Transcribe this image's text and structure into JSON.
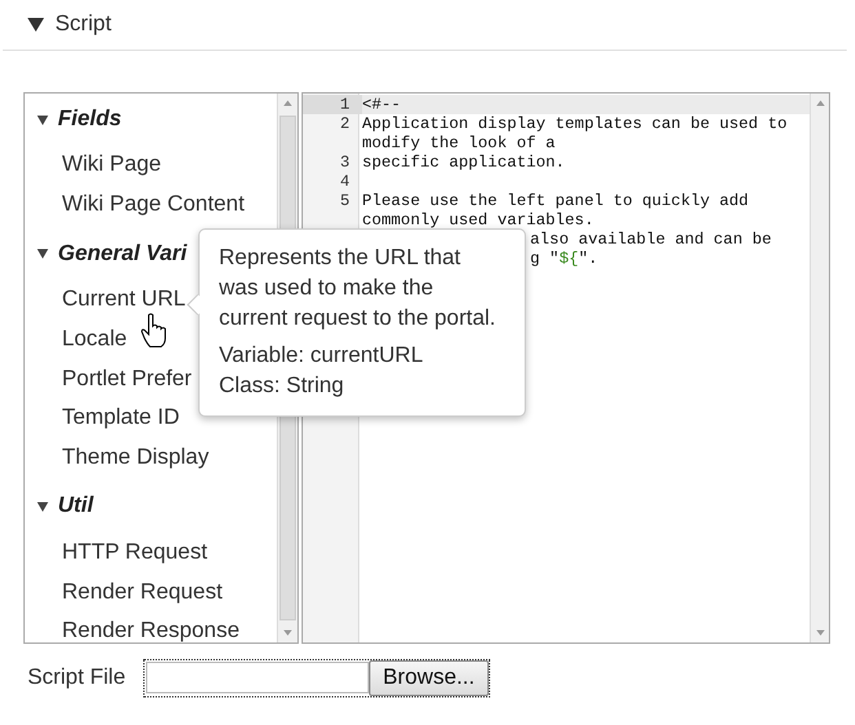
{
  "section": {
    "title": "Script",
    "expanded": true
  },
  "variables_panel": {
    "groups": [
      {
        "title": "Fields",
        "expanded": true,
        "items": [
          {
            "label": "Wiki Page"
          },
          {
            "label": "Wiki Page Content"
          }
        ]
      },
      {
        "title": "General Vari",
        "expanded": true,
        "items": [
          {
            "label": "Current URL"
          },
          {
            "label": "Locale"
          },
          {
            "label": "Portlet Prefer"
          },
          {
            "label": "Template ID"
          },
          {
            "label": "Theme Display"
          }
        ]
      },
      {
        "title": "Util",
        "expanded": true,
        "items": [
          {
            "label": "HTTP Request"
          },
          {
            "label": "Render Request"
          },
          {
            "label": "Render Response"
          }
        ]
      }
    ]
  },
  "editor": {
    "lines": [
      {
        "number": "1",
        "current": true,
        "parts": [
          {
            "kind": "plain",
            "text": "<#--"
          }
        ]
      },
      {
        "number": "2",
        "current": false,
        "parts": [
          {
            "kind": "plain",
            "text": "Application display templates can be used to modify the look of a"
          }
        ]
      },
      {
        "number": "3",
        "current": false,
        "parts": [
          {
            "kind": "plain",
            "text": "specific application."
          }
        ]
      },
      {
        "number": "4",
        "current": false
      },
      {
        "number": "5",
        "current": false,
        "parts": [
          {
            "kind": "plain",
            "text": "Please use the left panel to quickly add commonly used variables."
          }
        ]
      },
      {
        "kind": "partial",
        "current": false,
        "parts": [
          {
            "kind": "plain",
            "text": "also available and can be"
          }
        ]
      },
      {
        "kind": "partial",
        "current": false,
        "parts": [
          {
            "kind": "plain",
            "text": "g \""
          },
          {
            "kind": "string",
            "text": "${"
          },
          {
            "kind": "plain",
            "text": "\"."
          }
        ]
      }
    ]
  },
  "tooltip": {
    "description": "Represents the URL that was used to make the current request to the portal.",
    "variable": "Variable: currentURL",
    "class": "Class: String"
  },
  "script_file": {
    "label": "Script File",
    "button": "Browse..."
  }
}
